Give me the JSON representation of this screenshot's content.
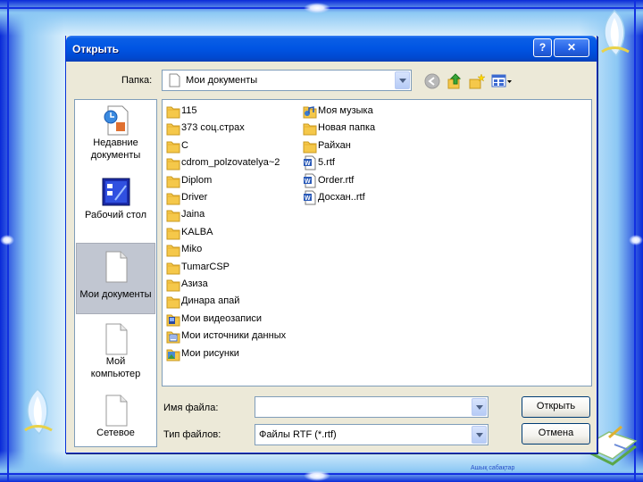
{
  "dialog": {
    "title": "Открыть",
    "help_button": "?",
    "close_button": "✕"
  },
  "toolbar": {
    "folder_label": "Папка:",
    "folder_value": "Мои документы",
    "icons": [
      "back-icon",
      "up-folder-icon",
      "new-folder-icon",
      "views-menu-icon"
    ]
  },
  "places": [
    {
      "label_lines": [
        "Недавние",
        "документы"
      ],
      "icon": "recent-documents-icon",
      "selected": false
    },
    {
      "label_lines": [
        "Рабочий стол"
      ],
      "icon": "desktop-icon",
      "selected": false
    },
    {
      "label_lines": [
        "Мои документы"
      ],
      "icon": "my-documents-icon",
      "selected": true
    },
    {
      "label_lines": [
        "Мой",
        "компьютер"
      ],
      "icon": "my-computer-icon",
      "selected": false
    },
    {
      "label_lines": [
        "Сетевое"
      ],
      "icon": "network-icon",
      "selected": false
    }
  ],
  "files_col1": [
    {
      "name": "115",
      "icon": "folder-icon"
    },
    {
      "name": "373 соц.страх",
      "icon": "folder-icon"
    },
    {
      "name": "С",
      "icon": "folder-icon"
    },
    {
      "name": "cdrom_polzovatelya~2",
      "icon": "folder-icon"
    },
    {
      "name": "Diplom",
      "icon": "folder-icon"
    },
    {
      "name": "Driver",
      "icon": "folder-icon"
    },
    {
      "name": "Jaina",
      "icon": "folder-icon"
    },
    {
      "name": "KALBA",
      "icon": "folder-icon"
    },
    {
      "name": "Miko",
      "icon": "folder-icon"
    },
    {
      "name": "TumarCSP",
      "icon": "folder-icon"
    },
    {
      "name": "Азиза",
      "icon": "folder-icon"
    },
    {
      "name": "Динара апай",
      "icon": "folder-icon"
    },
    {
      "name": "Мои видеозаписи",
      "icon": "video-folder-icon"
    },
    {
      "name": "Мои источники данных",
      "icon": "data-sources-folder-icon"
    },
    {
      "name": "Мои рисунки",
      "icon": "pictures-folder-icon"
    }
  ],
  "files_col2": [
    {
      "name": "Моя музыка",
      "icon": "music-folder-icon"
    },
    {
      "name": "Новая папка",
      "icon": "folder-icon"
    },
    {
      "name": "Райхан",
      "icon": "folder-icon"
    },
    {
      "name": "5.rtf",
      "icon": "rtf-file-icon"
    },
    {
      "name": "Order.rtf",
      "icon": "rtf-file-icon"
    },
    {
      "name": "Досхан..rtf",
      "icon": "rtf-file-icon"
    }
  ],
  "filename": {
    "label": "Имя файла:",
    "value": ""
  },
  "filetype": {
    "label": "Тип файлов:",
    "value": "Файлы RTF (*.rtf)"
  },
  "buttons": {
    "open": "Открыть",
    "cancel": "Отмена"
  },
  "slide": {
    "footer_caption": "Ашық сабақтар"
  },
  "colors": {
    "titlebar": "#0054e3",
    "dialog_bg": "#ece9d8",
    "selected_place": "#c1c6d1",
    "folder": "#f5c84a",
    "frame": "#1230e0"
  }
}
